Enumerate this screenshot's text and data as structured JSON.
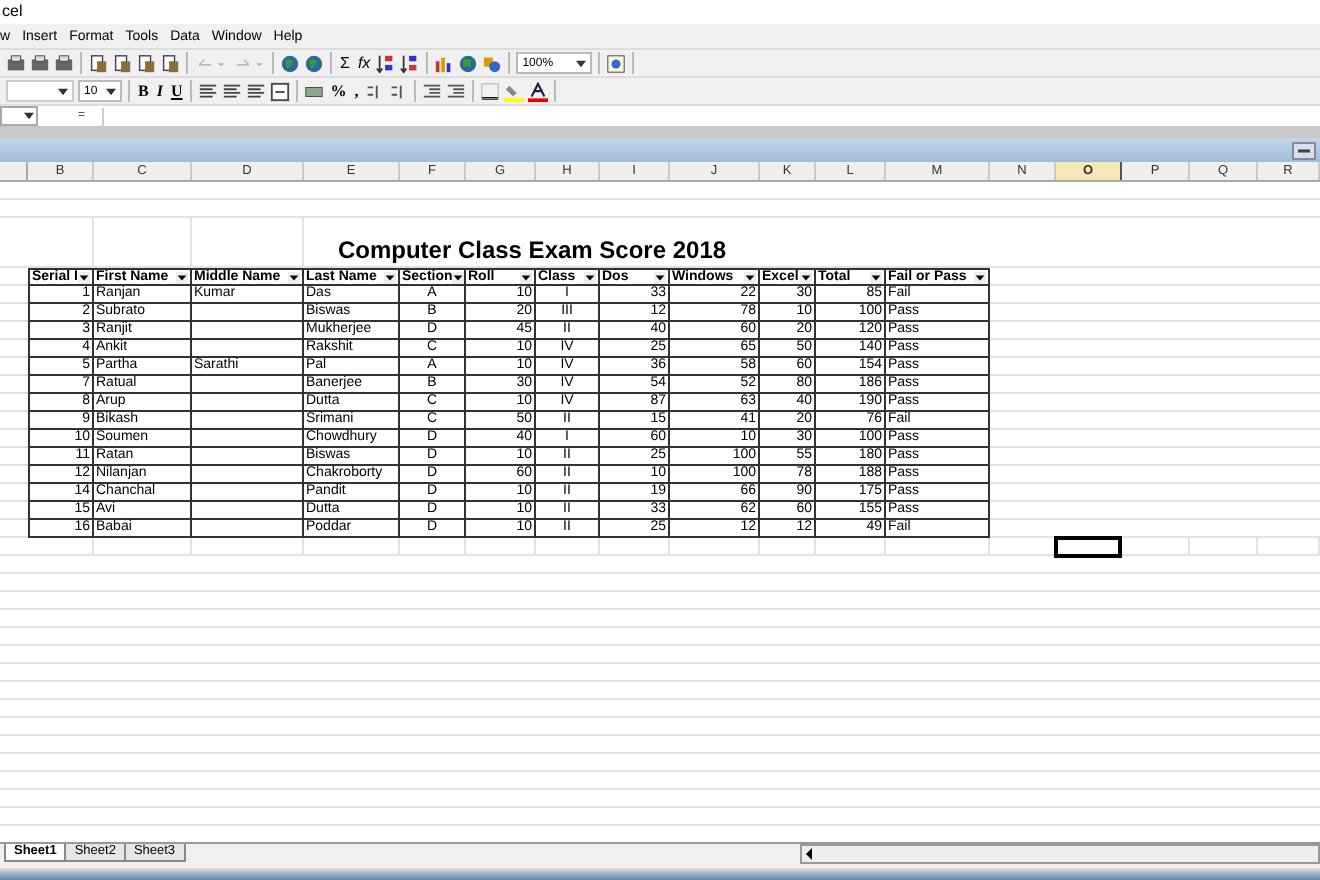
{
  "window": {
    "title": "cel"
  },
  "menu": [
    "w",
    "Insert",
    "Format",
    "Tools",
    "Data",
    "Window",
    "Help"
  ],
  "standard_toolbar": {
    "sum": "Σ",
    "function": "fx",
    "zoom": "100%"
  },
  "formatting_toolbar": {
    "font_size": "10",
    "bold": "B",
    "italic": "I",
    "underline": "U",
    "percent": "%",
    "comma": ","
  },
  "formula_bar": {
    "equals": "="
  },
  "columns": [
    {
      "label": "B",
      "selected": false
    },
    {
      "label": "C",
      "selected": false
    },
    {
      "label": "D",
      "selected": false
    },
    {
      "label": "E",
      "selected": false
    },
    {
      "label": "F",
      "selected": false
    },
    {
      "label": "G",
      "selected": false
    },
    {
      "label": "H",
      "selected": false
    },
    {
      "label": "I",
      "selected": false
    },
    {
      "label": "J",
      "selected": false
    },
    {
      "label": "K",
      "selected": false
    },
    {
      "label": "L",
      "selected": false
    },
    {
      "label": "M",
      "selected": false
    },
    {
      "label": "N",
      "selected": false
    },
    {
      "label": "O",
      "selected": true
    },
    {
      "label": "P",
      "selected": false
    },
    {
      "label": "Q",
      "selected": false
    },
    {
      "label": "R",
      "selected": false
    }
  ],
  "sheet_title": "Computer Class Exam Score 2018",
  "table": {
    "columns": [
      "Serial I",
      "First Name",
      "Middle Name",
      "Last Name",
      "Section",
      "Roll",
      "Class",
      "Dos",
      "Windows",
      "Excel",
      "Total",
      "Fail or Pass"
    ],
    "rows": [
      [
        "1",
        "Ranjan",
        "Kumar",
        "Das",
        "A",
        "10",
        "I",
        "33",
        "22",
        "30",
        "85",
        "Fail"
      ],
      [
        "2",
        "Subrato",
        "",
        "Biswas",
        "B",
        "20",
        "III",
        "12",
        "78",
        "10",
        "100",
        "Pass"
      ],
      [
        "3",
        "Ranjit",
        "",
        "Mukherjee",
        "D",
        "45",
        "II",
        "40",
        "60",
        "20",
        "120",
        "Pass"
      ],
      [
        "4",
        "Ankit",
        "",
        "Rakshit",
        "C",
        "10",
        "IV",
        "25",
        "65",
        "50",
        "140",
        "Pass"
      ],
      [
        "5",
        "Partha",
        "Sarathi",
        "Pal",
        "A",
        "10",
        "IV",
        "36",
        "58",
        "60",
        "154",
        "Pass"
      ],
      [
        "7",
        "Ratual",
        "",
        "Banerjee",
        "B",
        "30",
        "IV",
        "54",
        "52",
        "80",
        "186",
        "Pass"
      ],
      [
        "8",
        "Arup",
        "",
        "Dutta",
        "C",
        "10",
        "IV",
        "87",
        "63",
        "40",
        "190",
        "Pass"
      ],
      [
        "9",
        "Bikash",
        "",
        "Srimani",
        "C",
        "50",
        "II",
        "15",
        "41",
        "20",
        "76",
        "Fail"
      ],
      [
        "10",
        "Soumen",
        "",
        "Chowdhury",
        "D",
        "40",
        "I",
        "60",
        "10",
        "30",
        "100",
        "Pass"
      ],
      [
        "11",
        "Ratan",
        "",
        "Biswas",
        "D",
        "10",
        "II",
        "25",
        "100",
        "55",
        "180",
        "Pass"
      ],
      [
        "12",
        "Nilanjan",
        "",
        "Chakroborty",
        "D",
        "60",
        "II",
        "10",
        "100",
        "78",
        "188",
        "Pass"
      ],
      [
        "14",
        "Chanchal",
        "",
        "Pandit",
        "D",
        "10",
        "II",
        "19",
        "66",
        "90",
        "175",
        "Pass"
      ],
      [
        "15",
        "Avi",
        "",
        "Dutta",
        "D",
        "10",
        "II",
        "33",
        "62",
        "60",
        "155",
        "Pass"
      ],
      [
        "16",
        "Babai",
        "",
        "Poddar",
        "D",
        "10",
        "II",
        "25",
        "12",
        "12",
        "49",
        "Fail"
      ]
    ]
  },
  "sheet_tabs": [
    {
      "label": "Sheet1",
      "selected": true
    },
    {
      "label": "Sheet2",
      "selected": false
    },
    {
      "label": "Sheet3",
      "selected": false
    }
  ]
}
